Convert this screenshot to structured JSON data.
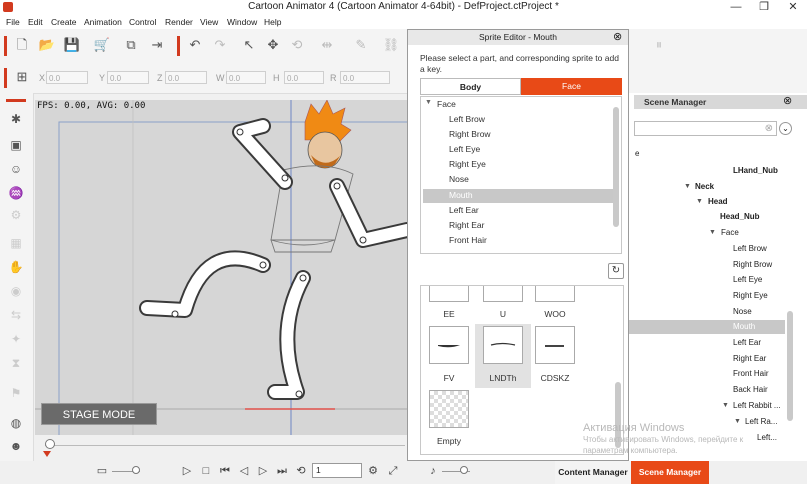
{
  "window": {
    "title": "Cartoon Animator 4  (Cartoon Animator 4-64bit) - DefProject.ctProject *",
    "minimize": "—",
    "restore": "❐",
    "close": "✕"
  },
  "menu": [
    "File",
    "Edit",
    "Create",
    "Animation",
    "Control",
    "Render",
    "View",
    "Window",
    "Help"
  ],
  "transform": {
    "x_label": "X",
    "x_value": "0.0",
    "y_label": "Y",
    "y_value": "0.0",
    "z_label": "Z",
    "z_value": "0.0",
    "w_label": "W",
    "w_value": "0.0",
    "h_label": "H",
    "h_value": "0.0",
    "r_label": "R",
    "r_value": "0.0"
  },
  "stage": {
    "fps_text": "FPS: 0.00, AVG: 0.00",
    "mode_label": "STAGE MODE"
  },
  "transport": {
    "frame_value": "1"
  },
  "sprite_editor": {
    "title": "Sprite Editor - Mouth",
    "close": "⊗",
    "instruction": "Please select a part, and corresponding sprite to add a key.",
    "tab_body": "Body",
    "tab_face": "Face",
    "parts_header": "Face",
    "parts": [
      "Left Brow",
      "Right Brow",
      "Left Eye",
      "Right Eye",
      "Nose",
      "Mouth",
      "Left Ear",
      "Right Ear",
      "Front Hair"
    ],
    "selected_part": "Mouth",
    "refresh_icon": "↻",
    "sprites_top": [
      "EE",
      "U",
      "WOO"
    ],
    "sprites_mid": [
      "FV",
      "LNDTh",
      "CDSKZ"
    ],
    "sprites_bottom": [
      "Empty"
    ]
  },
  "scene_manager": {
    "title": "Scene Manager",
    "close": "⊗",
    "nodes": [
      {
        "label": "LHand_Nub",
        "bold": true
      },
      {
        "label": "Neck",
        "bold": true
      },
      {
        "label": "Head",
        "bold": true
      },
      {
        "label": "Head_Nub",
        "bold": true
      },
      {
        "label": "Face",
        "bold": false
      },
      {
        "label": "Left Brow",
        "bold": false
      },
      {
        "label": "Right Brow",
        "bold": false
      },
      {
        "label": "Left Eye",
        "bold": false
      },
      {
        "label": "Right Eye",
        "bold": false
      },
      {
        "label": "Nose",
        "bold": false
      },
      {
        "label": "Mouth",
        "bold": false
      },
      {
        "label": "Left Ear",
        "bold": false
      },
      {
        "label": "Right Ear",
        "bold": false
      },
      {
        "label": "Front Hair",
        "bold": false
      },
      {
        "label": "Back Hair",
        "bold": false
      },
      {
        "label": "Left Rabbit ...",
        "bold": false
      },
      {
        "label": "Left Ra...",
        "bold": false
      },
      {
        "label": "Left...",
        "bold": false
      }
    ]
  },
  "bottom_tabs": {
    "content_manager": "Content Manager",
    "scene_manager": "Scene Manager"
  },
  "watermark": {
    "line1": "Активация Windows",
    "line2": "Чтобы активировать Windows, перейдите к",
    "line3": "параметрам компьютера."
  },
  "colors": {
    "accent": "#e84a17",
    "selection": "#c8c8c8",
    "stage_bg": "#d6d6d6"
  }
}
